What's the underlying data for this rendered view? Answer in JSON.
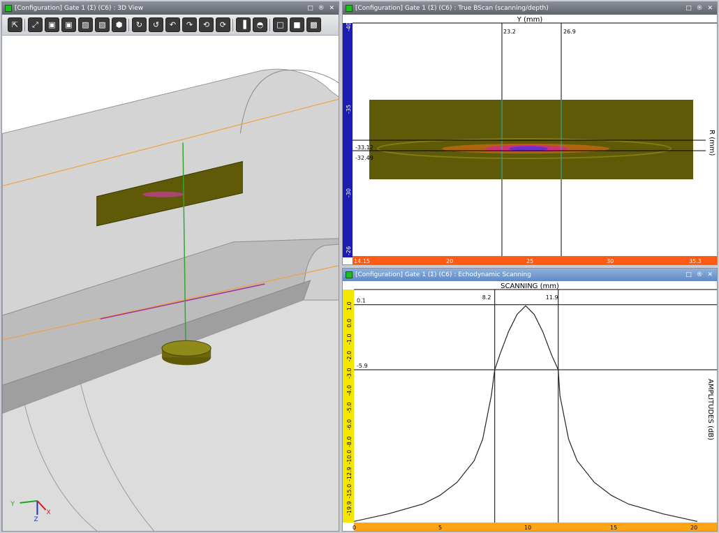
{
  "panels": {
    "view3d": {
      "title": "[Configuration] Gate 1 (Σ) (C6) : 3D View",
      "controls": "□ ® ✕"
    },
    "bscan": {
      "title": "[Configuration] Gate 1 (Σ) (C6) : True BScan (scanning/depth)",
      "controls": "□ ® ✕",
      "top_axis_label": "Y (mm)",
      "right_axis_label": "R (mm)",
      "cursor_x1": "23.2",
      "cursor_x2": "26.9",
      "cursor_y1": "-33.12",
      "cursor_y2": "-32.49",
      "left_ticks": [
        "-40",
        "-35",
        "-30",
        "-26"
      ],
      "bottom_ticks": [
        "14.15",
        "20",
        "25",
        "30",
        "35.3"
      ]
    },
    "echo": {
      "title": "[Configuration] Gate 1 (Σ) (C6) : Echodynamic Scanning",
      "controls": "□ ® ✕",
      "top_axis_label": "SCANNING (mm)",
      "right_axis_label": "AMPLITUDES (dB)",
      "cursor_x1": "8.2",
      "cursor_x2": "11.9",
      "cursor_y1": "0.1",
      "cursor_y2": "-5.9",
      "left_ticks": [
        "1.0",
        "0.0",
        "-1.0",
        "-2.0",
        "-3.0",
        "-4.0",
        "-5.0",
        "-6.0",
        "-8.0",
        "-10.0",
        "-12.9",
        "-15.0",
        "-19.9"
      ],
      "bottom_ticks": [
        "0",
        "5",
        "10",
        "15",
        "20"
      ]
    }
  },
  "axis_triad": {
    "y": "Y",
    "z": "Z",
    "x": "X"
  },
  "toolbar_buttons": [
    {
      "name": "select-cursor-button",
      "glyph": "⇱"
    },
    {
      "name": "fit-view-button",
      "glyph": "⤢"
    },
    {
      "name": "view-front-button",
      "glyph": "▣"
    },
    {
      "name": "view-back-button",
      "glyph": "▣"
    },
    {
      "name": "view-left-button",
      "glyph": "▨"
    },
    {
      "name": "view-right-button",
      "glyph": "▧"
    },
    {
      "name": "view-iso-button",
      "glyph": "⬢"
    },
    {
      "name": "rotate-down-button",
      "glyph": "↻"
    },
    {
      "name": "rotate-up-button",
      "glyph": "↺"
    },
    {
      "name": "rotate-left-button",
      "glyph": "↶"
    },
    {
      "name": "rotate-right-button",
      "glyph": "↷"
    },
    {
      "name": "rotate-ccw-button",
      "glyph": "⟲"
    },
    {
      "name": "rotate-cw-button",
      "glyph": "⟳"
    },
    {
      "name": "section-button",
      "glyph": "▐"
    },
    {
      "name": "protractor-button",
      "glyph": "◓"
    },
    {
      "name": "wireframe-button",
      "glyph": "□"
    },
    {
      "name": "solid-button",
      "glyph": "■"
    },
    {
      "name": "hatch-button",
      "glyph": "▩"
    }
  ],
  "chart_data": [
    {
      "type": "line",
      "title": "",
      "xlabel": "SCANNING (mm)",
      "ylabel": "AMPLITUDES (dB)",
      "xlim": [
        0,
        20
      ],
      "ylim": [
        -20,
        1.5
      ],
      "x": [
        0,
        2,
        4,
        5,
        6,
        7,
        7.5,
        8,
        8.2,
        8.5,
        9,
        9.5,
        10,
        10.5,
        11,
        11.5,
        11.9,
        12,
        12.5,
        13,
        14,
        15,
        16,
        18,
        20
      ],
      "series": [
        {
          "values": [
            -19.9,
            -19.2,
            -18.3,
            -17.5,
            -16.3,
            -14.3,
            -12.3,
            -8.3,
            -5.9,
            -4.5,
            -2.4,
            -0.8,
            0.0,
            -0.8,
            -2.4,
            -4.5,
            -5.9,
            -8.3,
            -12.3,
            -14.3,
            -16.3,
            -17.5,
            -18.3,
            -19.2,
            -19.9
          ]
        }
      ]
    }
  ]
}
